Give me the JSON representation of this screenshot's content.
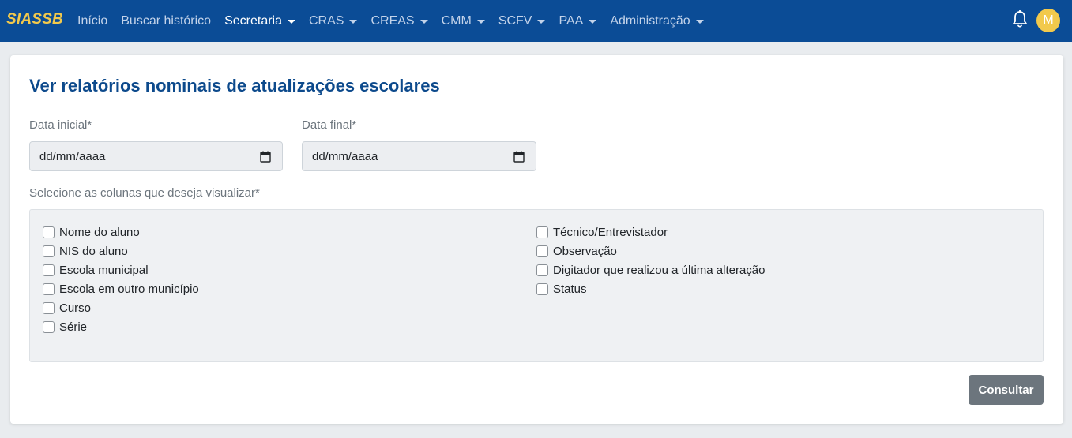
{
  "brand": "SIASSB",
  "nav": {
    "items": [
      {
        "label": "Início",
        "dropdown": false,
        "active": false
      },
      {
        "label": "Buscar histórico",
        "dropdown": false,
        "active": false
      },
      {
        "label": "Secretaria",
        "dropdown": true,
        "active": true
      },
      {
        "label": "CRAS",
        "dropdown": true,
        "active": false
      },
      {
        "label": "CREAS",
        "dropdown": true,
        "active": false
      },
      {
        "label": "CMM",
        "dropdown": true,
        "active": false
      },
      {
        "label": "SCFV",
        "dropdown": true,
        "active": false
      },
      {
        "label": "PAA",
        "dropdown": true,
        "active": false
      },
      {
        "label": "Administração",
        "dropdown": true,
        "active": false
      }
    ],
    "notifications_icon": "bell-icon",
    "avatar_initial": "M"
  },
  "page": {
    "title": "Ver relatórios nominais de atualizações escolares",
    "start_date": {
      "label": "Data inicial*",
      "value": "dd/mm/aaaa"
    },
    "end_date": {
      "label": "Data final*",
      "value": "dd/mm/aaaa"
    },
    "columns_label": "Selecione as colunas que deseja visualizar*",
    "columns_left": [
      "Nome do aluno",
      "NIS do aluno",
      "Escola municipal",
      "Escola em outro município",
      "Curso",
      "Série"
    ],
    "columns_right": [
      "Técnico/Entrevistador",
      "Observação",
      "Digitador que realizou a última alteração",
      "Status"
    ],
    "submit_label": "Consultar"
  },
  "colors": {
    "navbar": "#0b4c96",
    "brand": "#f2c94c",
    "title": "#0d4a8c",
    "button": "#6c757d"
  }
}
